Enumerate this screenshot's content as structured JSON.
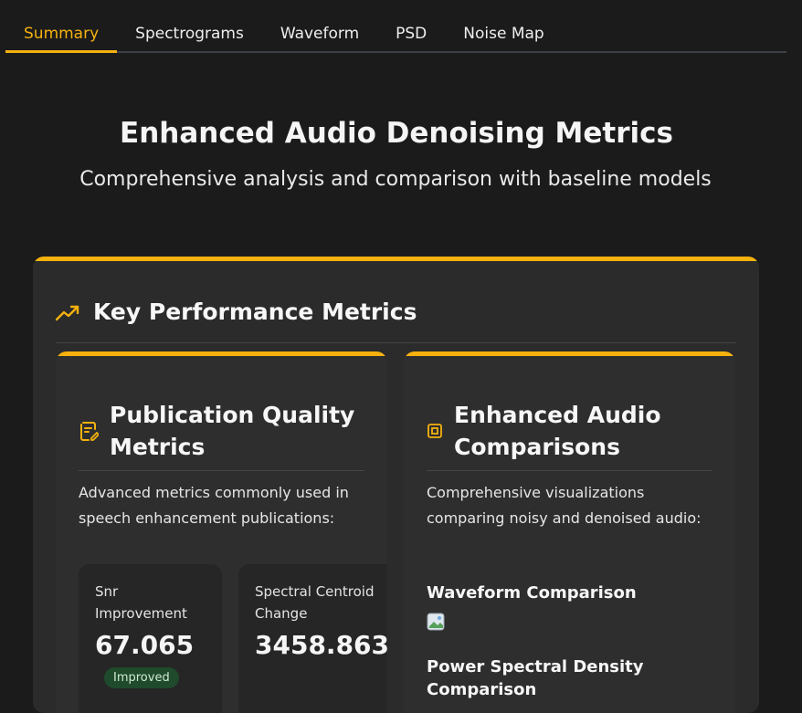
{
  "tabs": [
    {
      "label": "Summary",
      "active": true
    },
    {
      "label": "Spectrograms",
      "active": false
    },
    {
      "label": "Waveform",
      "active": false
    },
    {
      "label": "PSD",
      "active": false
    },
    {
      "label": "Noise Map",
      "active": false
    }
  ],
  "hero": {
    "title": "Enhanced Audio Denoising Metrics",
    "subtitle": "Comprehensive analysis and comparison with baseline models"
  },
  "panel": {
    "title": "Key Performance Metrics",
    "icon": "trending-up-icon"
  },
  "cards": {
    "publication": {
      "icon": "document-icon",
      "title": "Publication Quality Metrics",
      "description": "Advanced metrics commonly used in speech enhancement publications:",
      "metrics": [
        {
          "label": "Snr Improvement",
          "value": "67.065",
          "badge": "Improved"
        },
        {
          "label": "Spectral Centroid Change",
          "value": "3458.863"
        }
      ]
    },
    "comparisons": {
      "icon": "square-icon",
      "title": "Enhanced Audio Comparisons",
      "description": "Comprehensive visualizations comparing noisy and denoised audio:",
      "sections": [
        {
          "title": "Waveform Comparison"
        },
        {
          "title": "Power Spectral Density Comparison"
        }
      ]
    }
  },
  "colors": {
    "accent": "#f5b20e",
    "background": "#1b1b1b",
    "panel": "#2b2b2b",
    "badge_bg": "#1f4a2b"
  }
}
